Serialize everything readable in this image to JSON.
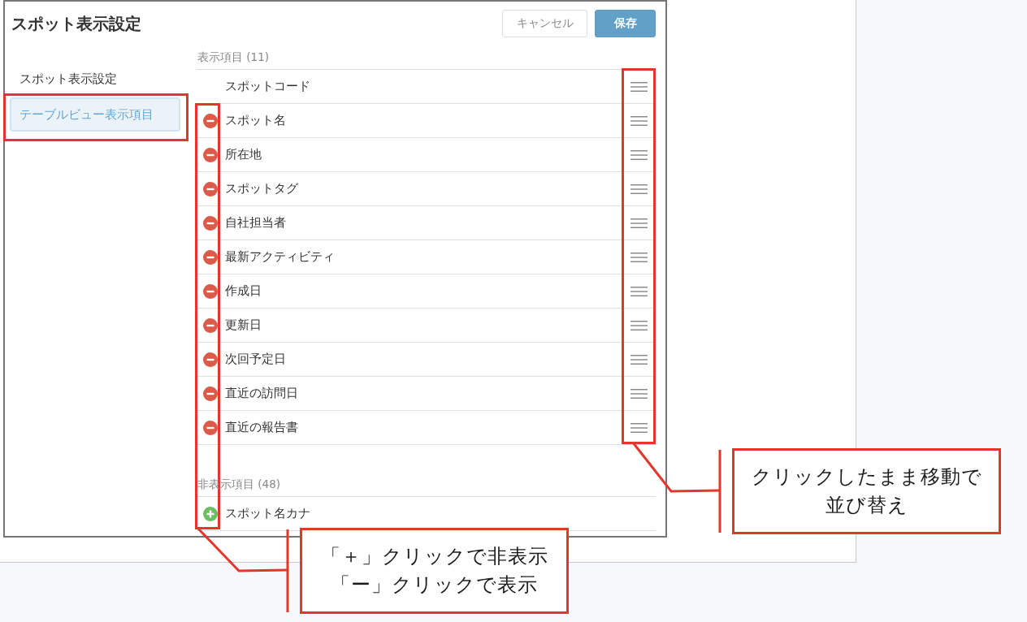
{
  "dialog": {
    "title": "スポット表示設定",
    "buttons": [
      {
        "label": "キャンセル",
        "kind": "secondary"
      },
      {
        "label": "保存",
        "kind": "primary"
      }
    ]
  },
  "sidebar": {
    "items": [
      {
        "label": "スポット表示設定",
        "selected": false
      },
      {
        "label": "テーブルビュー表示項目",
        "selected": true
      }
    ]
  },
  "sections": [
    {
      "title": "表示項目 (11)",
      "sortable": true,
      "items": [
        {
          "label": "スポットコード",
          "kind": "fixed"
        },
        {
          "label": "スポット名",
          "kind": "removable"
        },
        {
          "label": "所在地",
          "kind": "removable"
        },
        {
          "label": "スポットタグ",
          "kind": "removable"
        },
        {
          "label": "自社担当者",
          "kind": "removable"
        },
        {
          "label": "最新アクティビティ",
          "kind": "removable"
        },
        {
          "label": "作成日",
          "kind": "removable"
        },
        {
          "label": "更新日",
          "kind": "removable"
        },
        {
          "label": "次回予定日",
          "kind": "removable"
        },
        {
          "label": "直近の訪問日",
          "kind": "removable"
        },
        {
          "label": "直近の報告書",
          "kind": "removable"
        }
      ]
    },
    {
      "title": "非表示項目 (48)",
      "sortable": false,
      "items": [
        {
          "label": "スポット名カナ",
          "kind": "addable"
        }
      ]
    }
  ],
  "annotations": [
    {
      "kind": "selection_frame"
    },
    {
      "kind": "handle_callout",
      "lines": [
        "クリックしたまま移動で",
        "並び替え"
      ]
    },
    {
      "kind": "toggle_callout",
      "lines": [
        "「＋」クリックで非表示",
        "「ー」クリックで表示"
      ]
    }
  ]
}
